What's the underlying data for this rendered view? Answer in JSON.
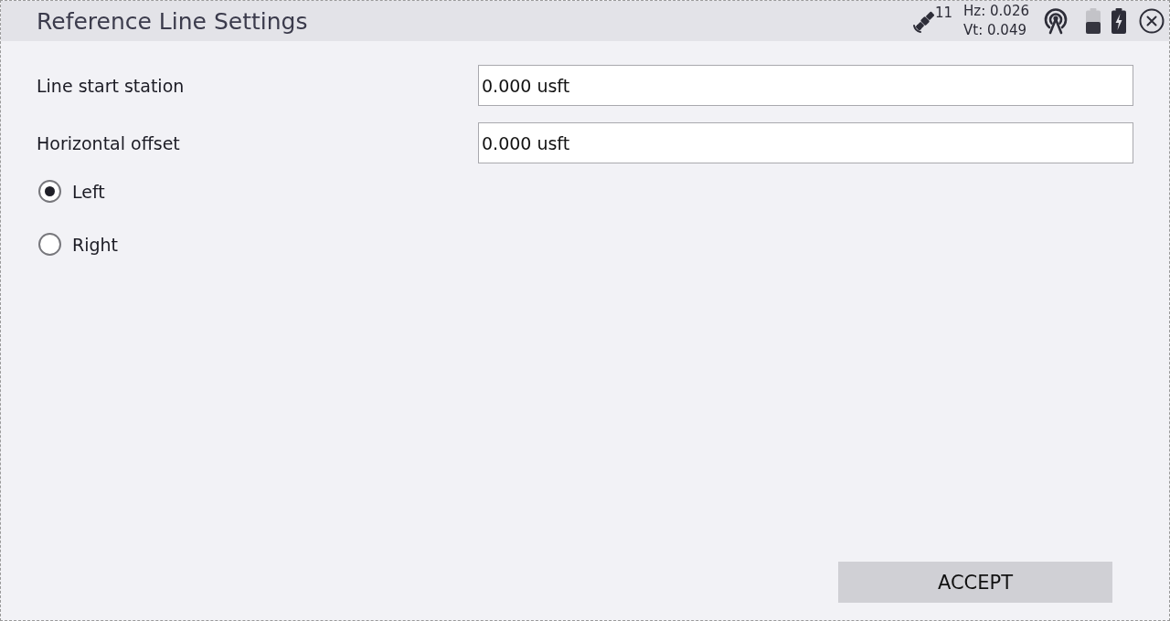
{
  "header": {
    "title": "Reference Line Settings",
    "status": {
      "satellite_count": "11",
      "hz": "Hz: 0.026",
      "vt": "Vt: 0.049"
    }
  },
  "fields": [
    {
      "label": "Line start station",
      "value": "0.000 usft"
    },
    {
      "label": "Horizontal offset",
      "value": "0.000 usft"
    }
  ],
  "offset_side": [
    {
      "label": "Left",
      "selected": true
    },
    {
      "label": "Right",
      "selected": false
    }
  ],
  "buttons": [
    {
      "label": "ACCEPT"
    }
  ]
}
